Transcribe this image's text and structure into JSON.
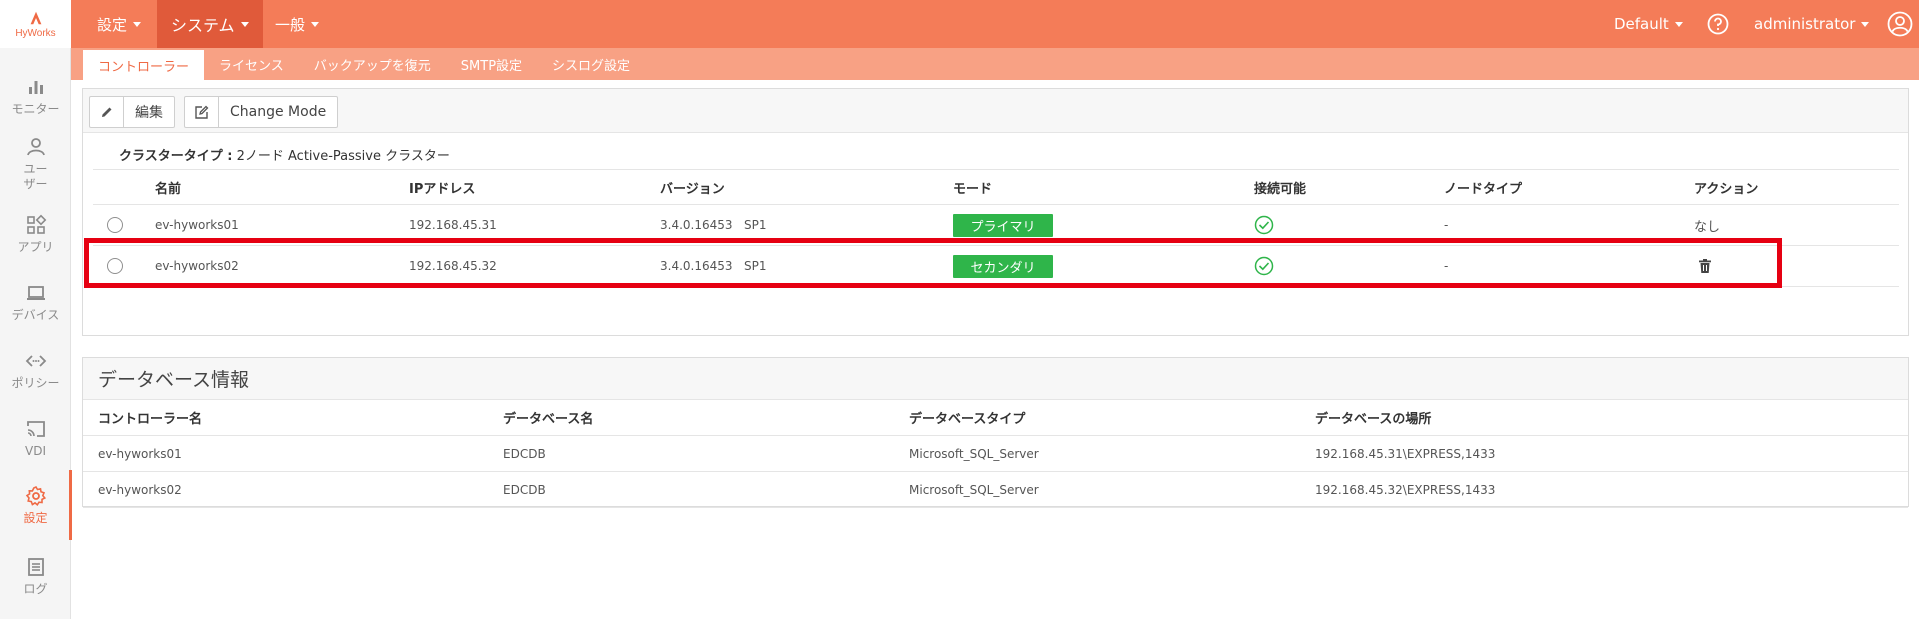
{
  "brand": {
    "name": "HyWorks",
    "accent": "#ef6a45"
  },
  "sidebar": {
    "items": [
      {
        "label": "モニター",
        "icon": "bar-chart-icon"
      },
      {
        "label": "ユーザー",
        "icon": "user-icon"
      },
      {
        "label": "アプリ",
        "icon": "apps-grid-icon"
      },
      {
        "label": "デバイス",
        "icon": "laptop-icon"
      },
      {
        "label": "ポリシー",
        "icon": "code-arrows-icon"
      },
      {
        "label": "VDI",
        "icon": "cast-icon"
      },
      {
        "label": "設定",
        "icon": "gear-icon",
        "active": true
      },
      {
        "label": "ログ",
        "icon": "log-document-icon"
      }
    ]
  },
  "topbar": {
    "menus": [
      "設定",
      "システム",
      "一般"
    ],
    "active_menu": "システム",
    "org": "Default",
    "user": "administrator"
  },
  "subtabs": [
    "コントローラー",
    "ライセンス",
    "バックアップを復元",
    "SMTP設定",
    "シスログ設定"
  ],
  "active_subtab": "コントローラー",
  "toolbar": {
    "edit_label": "編集",
    "change_mode_label": "Change Mode"
  },
  "cluster": {
    "type_label": "クラスタータイプ :",
    "type_value": "2ノード Active-Passive クラスター"
  },
  "controllers": {
    "columns": [
      "名前",
      "IPアドレス",
      "バージョン",
      "モード",
      "接続可能",
      "ノードタイプ",
      "アクション"
    ],
    "rows": [
      {
        "name": "ev-hyworks01",
        "ip": "192.168.45.31",
        "version": "3.4.0.16453   SP1",
        "mode": "プライマリ",
        "reachable": true,
        "node_type": "-",
        "action": "なし"
      },
      {
        "name": "ev-hyworks02",
        "ip": "192.168.45.32",
        "version": "3.4.0.16453   SP1",
        "mode": "セカンダリ",
        "reachable": true,
        "node_type": "-",
        "action": "trash-icon"
      }
    ]
  },
  "database": {
    "title": "データベース情報",
    "columns": [
      "コントローラー名",
      "データベース名",
      "データベースタイプ",
      "データベースの場所"
    ],
    "rows": [
      {
        "controller": "ev-hyworks01",
        "db_name": "EDCDB",
        "db_type": "Microsoft_SQL_Server",
        "location": "192.168.45.31\\EXPRESS,1433"
      },
      {
        "controller": "ev-hyworks02",
        "db_name": "EDCDB",
        "db_type": "Microsoft_SQL_Server",
        "location": "192.168.45.32\\EXPRESS,1433"
      }
    ]
  },
  "colors": {
    "topbar": "#f47c58",
    "subtabs": "#f8a184",
    "active_menu": "#e05a3a",
    "badge_green": "#2fb54a",
    "highlight": "#e60012"
  }
}
